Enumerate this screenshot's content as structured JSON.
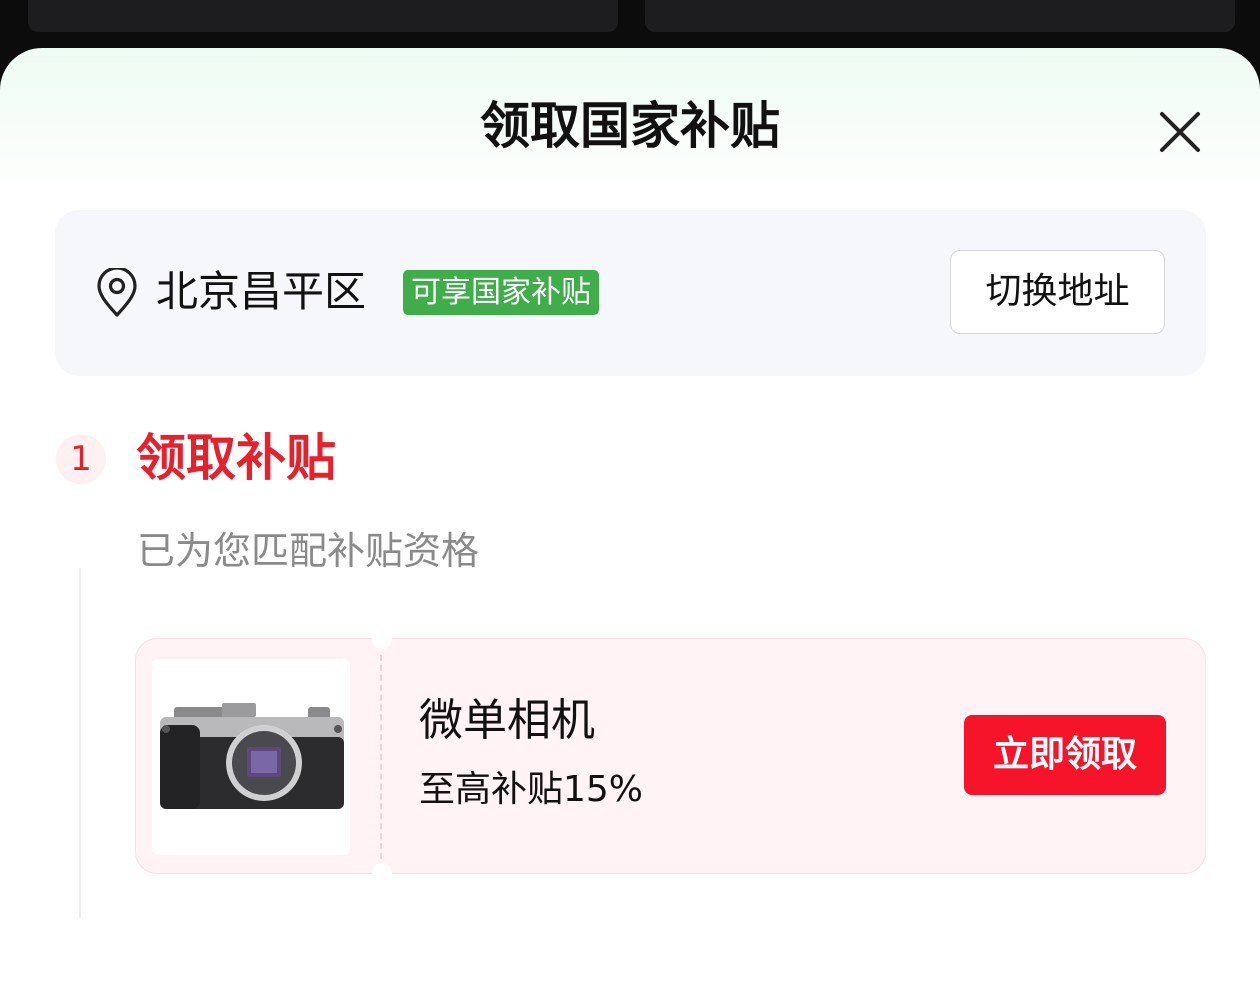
{
  "sheet": {
    "title": "领取国家补贴",
    "close_icon": "close-icon"
  },
  "address": {
    "location_icon": "map-pin-icon",
    "text": "北京昌平区",
    "badge": "可享国家补贴",
    "switch_label": "切换地址"
  },
  "step": {
    "number": "1",
    "title": "领取补贴",
    "description": "已为您匹配补贴资格"
  },
  "subsidy": {
    "product_image": "camera-image",
    "product_name": "微单相机",
    "subsidy_text": "至高补贴15%",
    "claim_label": "立即领取"
  },
  "colors": {
    "accent_red": "#f5142a",
    "badge_green": "#3fae4a",
    "card_pink": "#fff3f5"
  }
}
